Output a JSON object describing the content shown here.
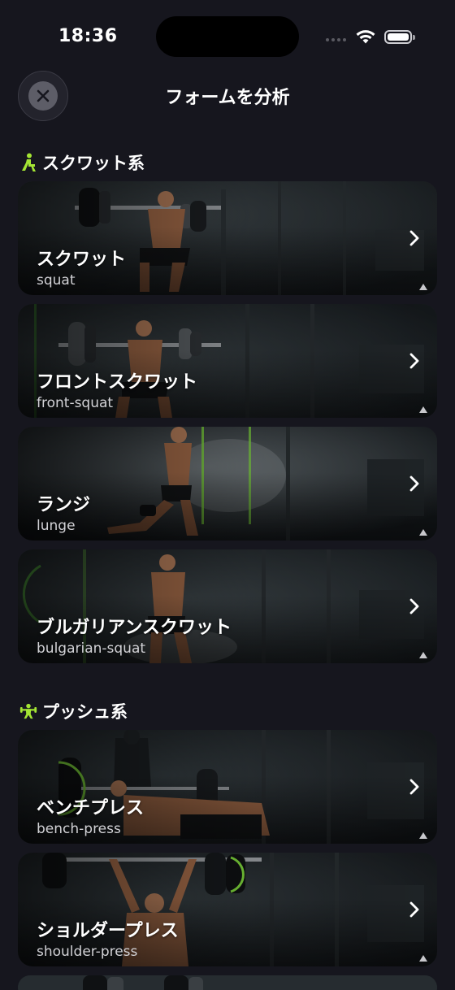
{
  "status_bar": {
    "time": "18:36"
  },
  "header": {
    "title": "フォームを分析"
  },
  "accent_color": "#a4e534",
  "sections": [
    {
      "title": "スクワット系",
      "icon": "squat-person-icon",
      "items": [
        {
          "title": "スクワット",
          "subtitle": "squat"
        },
        {
          "title": "フロントスクワット",
          "subtitle": "front-squat"
        },
        {
          "title": "ランジ",
          "subtitle": "lunge"
        },
        {
          "title": "ブルガリアンスクワット",
          "subtitle": "bulgarian-squat"
        }
      ]
    },
    {
      "title": "プッシュ系",
      "icon": "weightlifter-icon",
      "items": [
        {
          "title": "ベンチプレス",
          "subtitle": "bench-press"
        },
        {
          "title": "ショルダープレス",
          "subtitle": "shoulder-press"
        }
      ]
    }
  ]
}
